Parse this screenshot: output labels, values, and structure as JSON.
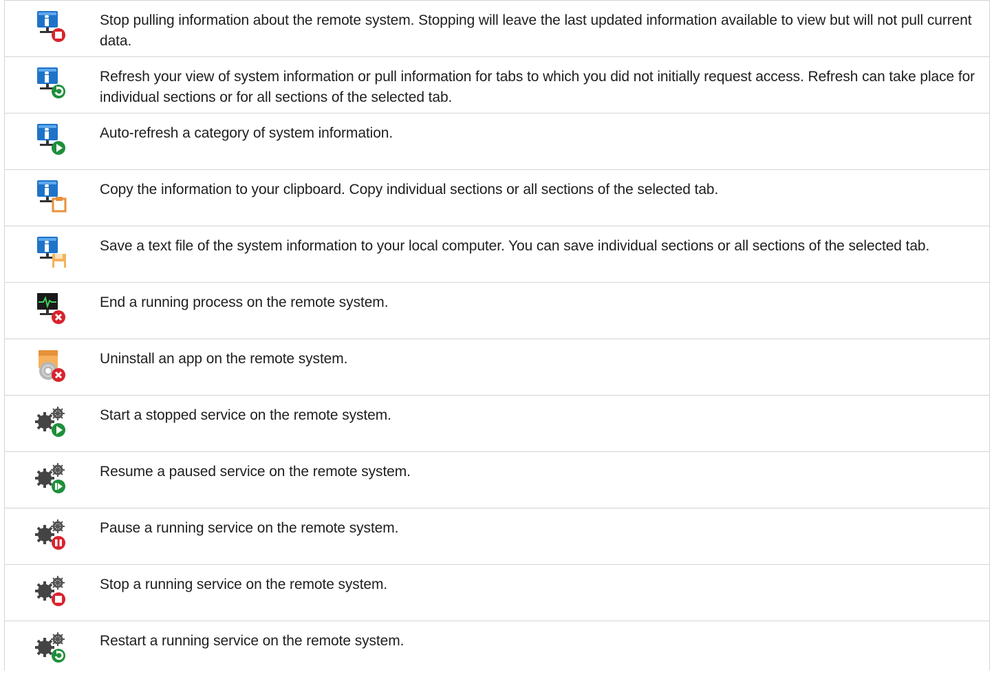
{
  "rows": [
    {
      "icon": "sysinfo-stop-icon",
      "text": "Stop pulling information about the remote system. Stopping will leave the last updated information available to view but will not pull current data."
    },
    {
      "icon": "sysinfo-refresh-icon",
      "text": "Refresh your view of system information or pull information for tabs to which you did not initially request access. Refresh can take place for individual sections or for all sections of the selected tab."
    },
    {
      "icon": "sysinfo-autorefresh-icon",
      "text": "Auto-refresh a category of system information."
    },
    {
      "icon": "sysinfo-copy-icon",
      "text": "Copy the information to your clipboard. Copy individual sections or all sections of the selected tab."
    },
    {
      "icon": "sysinfo-save-icon",
      "text": "Save a text file of the system information to your local computer. You can save individual sections or all sections of the selected tab."
    },
    {
      "icon": "end-process-icon",
      "text": "End a running process on the remote system."
    },
    {
      "icon": "uninstall-app-icon",
      "text": "Uninstall an app on the remote system."
    },
    {
      "icon": "service-start-icon",
      "text": "Start a stopped service on the remote system."
    },
    {
      "icon": "service-resume-icon",
      "text": "Resume a paused service on the remote system."
    },
    {
      "icon": "service-pause-icon",
      "text": "Pause a running service on the remote system."
    },
    {
      "icon": "service-stop-icon",
      "text": "Stop a running service on the remote system."
    },
    {
      "icon": "service-restart-icon",
      "text": "Restart a running service on the remote system."
    }
  ],
  "colors": {
    "monitor_blue": "#1e73c8",
    "stop_red": "#d9232d",
    "go_green": "#1f8f3a",
    "copy_orange": "#e8913a",
    "gear_gray": "#444444",
    "border": "#d4d4d4"
  }
}
